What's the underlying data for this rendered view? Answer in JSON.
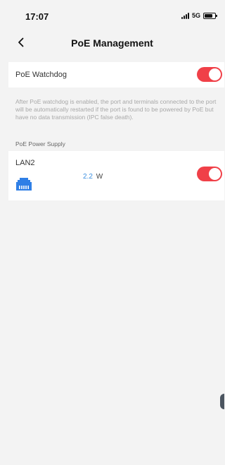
{
  "status_bar": {
    "time": "17:07",
    "network": "5G",
    "signal_icon": "signal-bars-icon",
    "battery_icon": "battery-icon",
    "battery_level": 0.8
  },
  "nav": {
    "back_icon": "chevron-left-icon",
    "title": "PoE Management"
  },
  "watchdog": {
    "label": "PoE Watchdog",
    "enabled": true,
    "description": "After PoE watchdog is enabled, the port and terminals connected to the port will be automatically restarted if the port is found to be powered by PoE but have no data transmission (IPC false death)."
  },
  "power_supply": {
    "section_label": "PoE Power Supply",
    "ports": [
      {
        "name": "LAN2",
        "icon": "ethernet-port-icon",
        "power_value": "2.2",
        "power_unit": "W",
        "enabled": true
      }
    ]
  },
  "colors": {
    "accent_toggle": "#f04048",
    "power_value": "#3b8fe0",
    "port_icon": "#2f7fe6",
    "background": "#f3f3f3"
  }
}
